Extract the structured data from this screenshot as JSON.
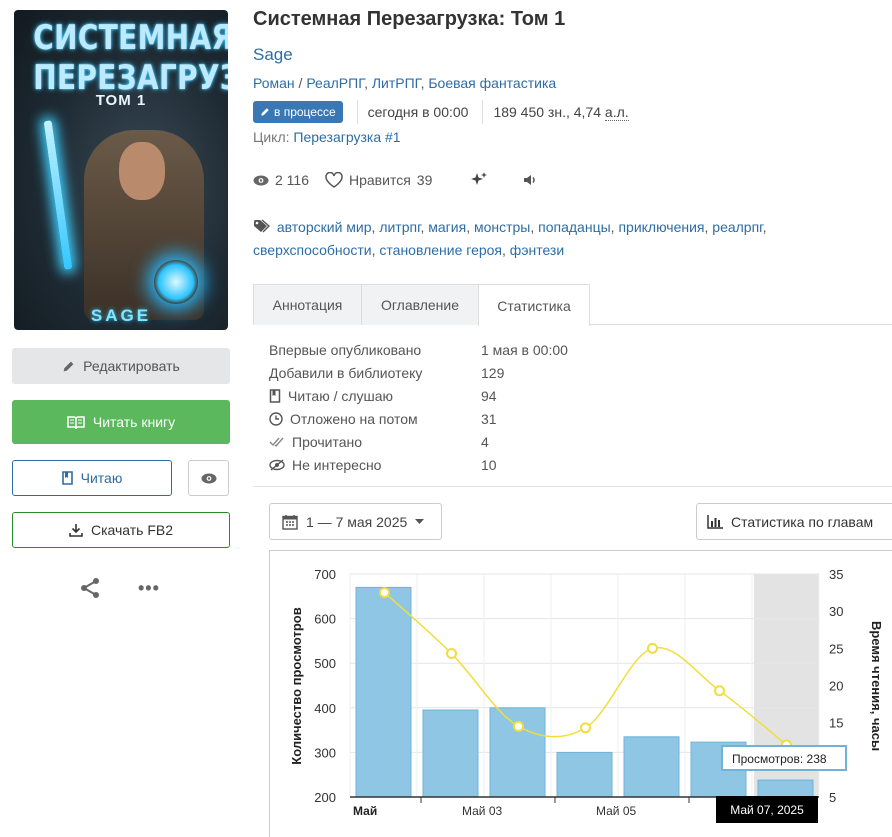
{
  "book": {
    "title": "Системная Перезагрузка: Том 1",
    "author": "Sage",
    "genres": [
      "Роман",
      "РеалРПГ",
      "ЛитРПГ",
      "Боевая фантастика"
    ],
    "status": "в процессе",
    "updated": "сегодня в 00:00",
    "size_chars": "189 450 зн.,",
    "size_al": "4,74",
    "size_al_unit": "а.л.",
    "cycle_label": "Цикл:",
    "cycle_name": "Перезагрузка",
    "cycle_num": "#1",
    "views": "2 116",
    "likes_label": "Нравится",
    "likes": "39",
    "tags": [
      "авторский мир",
      "литрпг",
      "магия",
      "монстры",
      "попаданцы",
      "приключения",
      "реалрпг",
      "сверхспособности",
      "становление героя",
      "фэнтези"
    ]
  },
  "cover": {
    "title": "СИСТЕМНАЯ ПЕРЕЗАГРУЗКА",
    "volume": "ТОМ 1",
    "author": "SAGE"
  },
  "actions": {
    "edit": "Редактировать",
    "read": "Читать книгу",
    "reading": "Читаю",
    "download": "Скачать FB2",
    "more": "•••"
  },
  "tabs": [
    "Аннотация",
    "Оглавление",
    "Статистика"
  ],
  "stats": [
    {
      "label": "Впервые опубликовано",
      "value": "1 мая в 00:00",
      "icon": ""
    },
    {
      "label": "Добавили в библиотеку",
      "value": "129",
      "icon": ""
    },
    {
      "label": "Читаю / слушаю",
      "value": "94",
      "icon": "bookmark-icon"
    },
    {
      "label": "Отложено на потом",
      "value": "31",
      "icon": "clock-icon"
    },
    {
      "label": "Прочитано",
      "value": "4",
      "icon": "double-check-icon"
    },
    {
      "label": "Не интересно",
      "value": "10",
      "icon": "eye-slash-icon"
    }
  ],
  "controls": {
    "date_range": "1 — 7 мая 2025",
    "chapters_stats": "Статистика по главам"
  },
  "chart_data": {
    "type": "bar",
    "categories": [
      "2025-05-01",
      "2025-05-02",
      "2025-05-03",
      "2025-05-04",
      "2025-05-05",
      "2025-05-06",
      "2025-05-07"
    ],
    "x_tick_labels": [
      "Май",
      "Май 03",
      "Май 05"
    ],
    "series": [
      {
        "name": "Просмотров",
        "type": "bar",
        "axis": "left",
        "values": [
          670,
          395,
          400,
          300,
          335,
          323,
          238
        ],
        "color": "#8fc6e3"
      },
      {
        "type": "line",
        "axis": "right",
        "values": [
          32.5,
          24.3,
          14.5,
          14.3,
          25,
          19.3,
          12
        ],
        "color": "#f0de3c"
      }
    ],
    "ylabel": "Количество просмотров",
    "ylabel_right": "Время чтения, часы",
    "ylim": [
      200,
      700
    ],
    "ylim_right": [
      5,
      35
    ],
    "yticks": [
      200,
      300,
      400,
      500,
      600,
      700
    ],
    "yticks_right": [
      5,
      10,
      15,
      20,
      25,
      30,
      35
    ],
    "tooltip": "Просмотров: 238",
    "crosshair_label": "Май 07, 2025",
    "grid": true
  }
}
